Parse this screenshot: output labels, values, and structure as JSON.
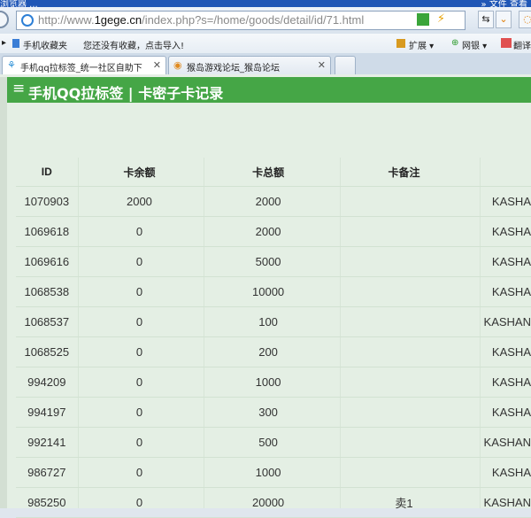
{
  "browser": {
    "titlebar_text": "浏览器 ...",
    "titlebar_right": "»  文件  查看",
    "address": {
      "url_prefix": "http://www.",
      "url_domain": "1gege.cn",
      "url_rest": "/index.php?s=/home/goods/detail/id/71.html"
    },
    "favorites": {
      "mobile_favorites": "手机收藏夹",
      "hint": "您还没有收藏，点击导入!",
      "extensions": "扩展",
      "netbank": "网银",
      "translate": "翻译"
    },
    "tabs": [
      {
        "label": "手机qq拉标签_统一社区自助下",
        "active": true
      },
      {
        "label": "猴岛游戏论坛_猴岛论坛",
        "active": false
      }
    ]
  },
  "page": {
    "menu_icon": "≡",
    "title": "手机QQ拉标签 | 卡密子卡记录"
  },
  "table": {
    "headers": [
      "ID",
      "卡余额",
      "卡总额",
      "卡备注",
      ""
    ],
    "rows": [
      {
        "id": "1070903",
        "balance": "2000",
        "total": "2000",
        "remark": "",
        "code": "KASHA"
      },
      {
        "id": "1069618",
        "balance": "0",
        "total": "2000",
        "remark": "",
        "code": "KASHA"
      },
      {
        "id": "1069616",
        "balance": "0",
        "total": "5000",
        "remark": "",
        "code": "KASHA"
      },
      {
        "id": "1068538",
        "balance": "0",
        "total": "10000",
        "remark": "",
        "code": "KASHA"
      },
      {
        "id": "1068537",
        "balance": "0",
        "total": "100",
        "remark": "",
        "code": "KASHAN"
      },
      {
        "id": "1068525",
        "balance": "0",
        "total": "200",
        "remark": "",
        "code": "KASHA"
      },
      {
        "id": "994209",
        "balance": "0",
        "total": "1000",
        "remark": "",
        "code": "KASHA"
      },
      {
        "id": "994197",
        "balance": "0",
        "total": "300",
        "remark": "",
        "code": "KASHA"
      },
      {
        "id": "992141",
        "balance": "0",
        "total": "500",
        "remark": "",
        "code": "KASHAN"
      },
      {
        "id": "986727",
        "balance": "0",
        "total": "1000",
        "remark": "",
        "code": "KASHA"
      },
      {
        "id": "985250",
        "balance": "0",
        "total": "20000",
        "remark": "卖1",
        "code": "KASHAN"
      }
    ]
  },
  "colors": {
    "header_green": "#45a646",
    "page_background": "#e4efe4"
  }
}
